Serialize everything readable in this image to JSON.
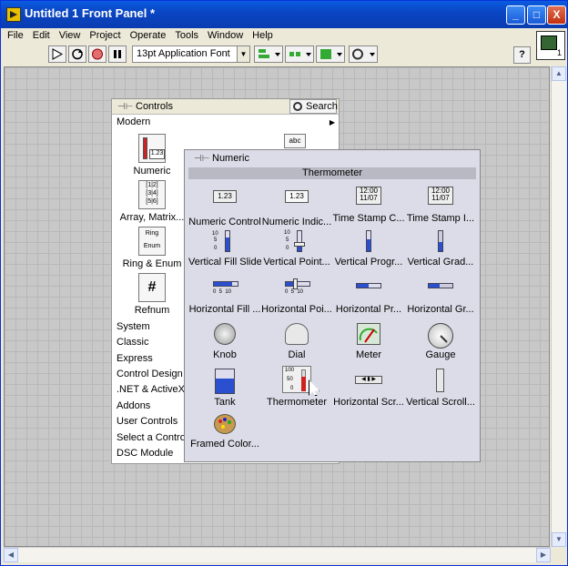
{
  "window": {
    "title": "Untitled 1 Front Panel *",
    "buttons": {
      "minimize": "_",
      "maximize": "□",
      "close": "X"
    }
  },
  "menu": [
    "File",
    "Edit",
    "View",
    "Project",
    "Operate",
    "Tools",
    "Window",
    "Help"
  ],
  "toolbar": {
    "font": "13pt Application Font",
    "help": "?"
  },
  "vi_icon": {
    "number": "1"
  },
  "controls_palette": {
    "title": "Controls",
    "search_label": "Search",
    "top_category": "Modern",
    "tiles": [
      {
        "label": "Numeric",
        "icon": "numeric-icon"
      },
      {
        "label": "Array, Matrix...",
        "icon": "array-matrix-icon"
      },
      {
        "label": "Ring & Enum",
        "icon": "ring-enum-icon",
        "glyph_top": "Ring",
        "glyph_bottom": "Enum"
      },
      {
        "label": "Refnum",
        "icon": "refnum-icon",
        "glyph": "#"
      }
    ],
    "top_tile_glyph": "abc",
    "categories": [
      "System",
      "Classic",
      "Express",
      "Control Design &",
      ".NET & ActiveX",
      "Addons",
      "User Controls",
      "Select a Control...",
      "DSC Module"
    ]
  },
  "numeric_subpalette": {
    "title": "Numeric",
    "hover_label": "Thermometer",
    "items": [
      {
        "label": "Numeric Control",
        "glyph": "1.23"
      },
      {
        "label": "Numeric Indic...",
        "glyph": "1.23"
      },
      {
        "label": "Time Stamp C...",
        "glyph": "12:00\n11/07"
      },
      {
        "label": "Time Stamp I...",
        "glyph": "12:00\n11/07"
      },
      {
        "label": "Vertical Fill Slide"
      },
      {
        "label": "Vertical Point..."
      },
      {
        "label": "Vertical Progr..."
      },
      {
        "label": "Vertical Grad..."
      },
      {
        "label": "Horizontal Fill ..."
      },
      {
        "label": "Horizontal Poi..."
      },
      {
        "label": "Horizontal Pr..."
      },
      {
        "label": "Horizontal Gr..."
      },
      {
        "label": "Knob"
      },
      {
        "label": "Dial"
      },
      {
        "label": "Meter"
      },
      {
        "label": "Gauge"
      },
      {
        "label": "Tank"
      },
      {
        "label": "Thermometer"
      },
      {
        "label": "Horizontal Scr..."
      },
      {
        "label": "Vertical Scroll..."
      },
      {
        "label": "Framed Color..."
      }
    ],
    "scale_labels": {
      "v_top": "10",
      "v_mid": "5",
      "v_bot": "0",
      "h": "0  5  10",
      "therm_top": "100",
      "therm_mid": "50",
      "therm_bot": "0"
    }
  },
  "colors": {
    "title_bar": "#0a4fd4",
    "canvas_grid": "#c8c8c8",
    "fill_blue": "#2a50d0",
    "mercury_red": "#d02020"
  }
}
